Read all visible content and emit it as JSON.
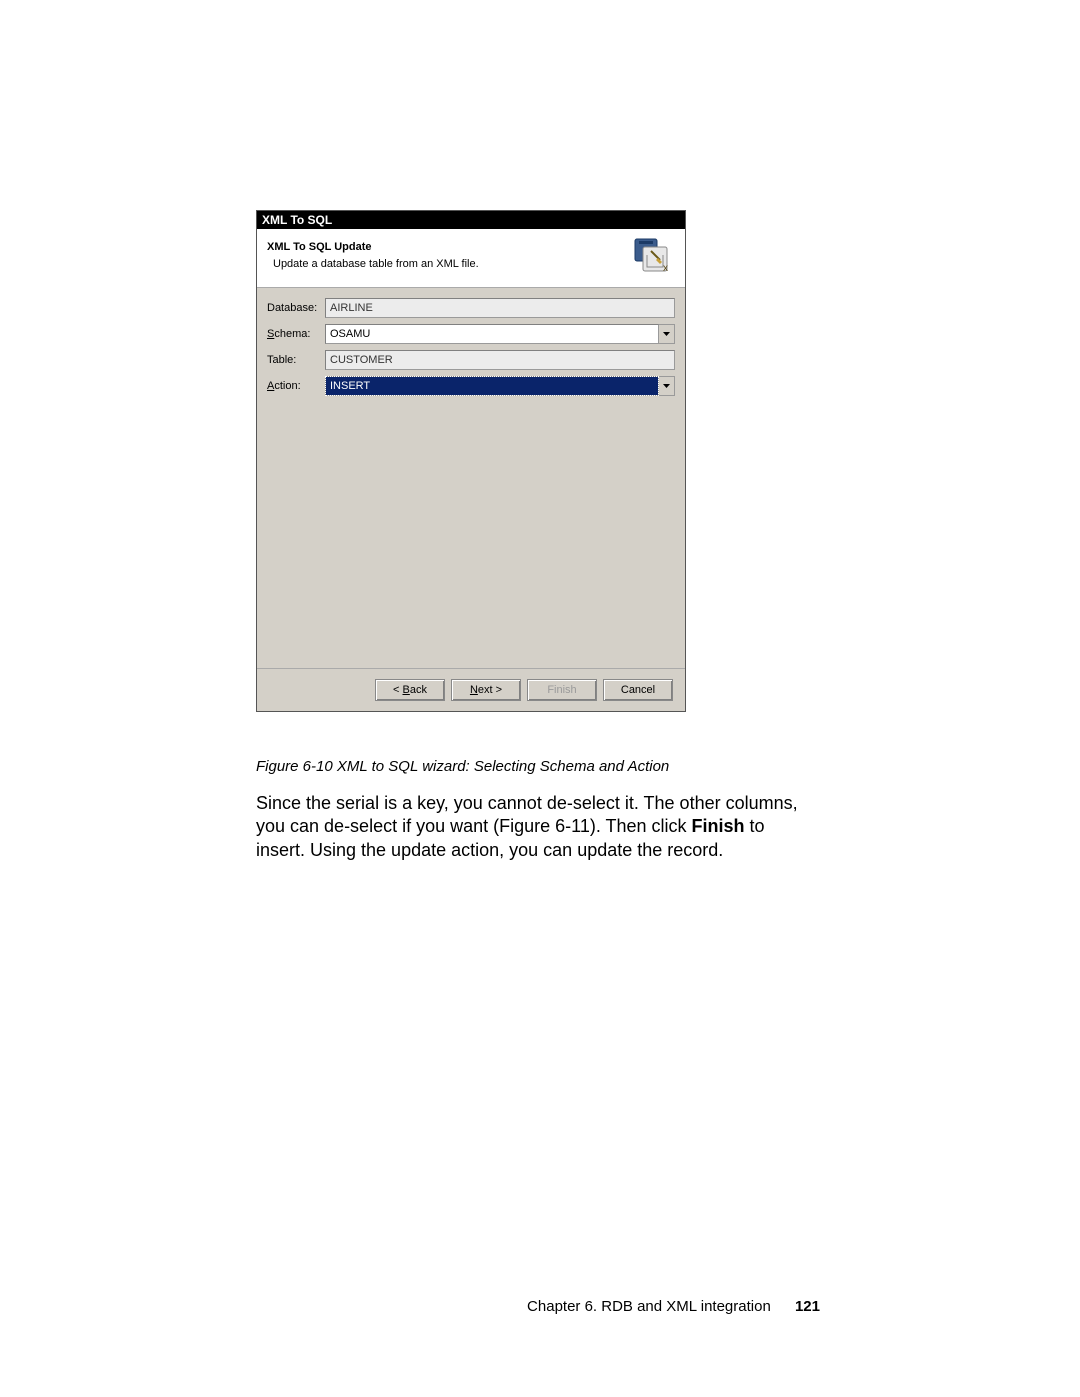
{
  "dialog": {
    "title": "XML To SQL",
    "header_title": "XML To SQL Update",
    "header_sub": "Update a database table from an XML file.",
    "fields": {
      "database_label": "Database:",
      "database_value": "AIRLINE",
      "schema_label_pre": "S",
      "schema_label_rest": "chema:",
      "schema_value": "OSAMU",
      "table_label": "Table:",
      "table_value": "CUSTOMER",
      "action_label_pre": "A",
      "action_label_rest": "ction:",
      "action_value": "INSERT"
    },
    "buttons": {
      "back_pre": "< ",
      "back_ul": "B",
      "back_rest": "ack",
      "next_ul": "N",
      "next_rest": "ext >",
      "finish": "Finish",
      "cancel": "Cancel"
    }
  },
  "caption": "Figure 6-10   XML to SQL wizard: Selecting Schema and Action",
  "paragraph_1": "Since the serial is a key, you cannot de-select it. The other columns, you can de-select if you want (Figure 6-11). Then click ",
  "paragraph_bold": "Finish",
  "paragraph_2": " to insert. Using the update action, you can update the record.",
  "footer_text": "Chapter 6. RDB and XML integration",
  "page_number": "121"
}
